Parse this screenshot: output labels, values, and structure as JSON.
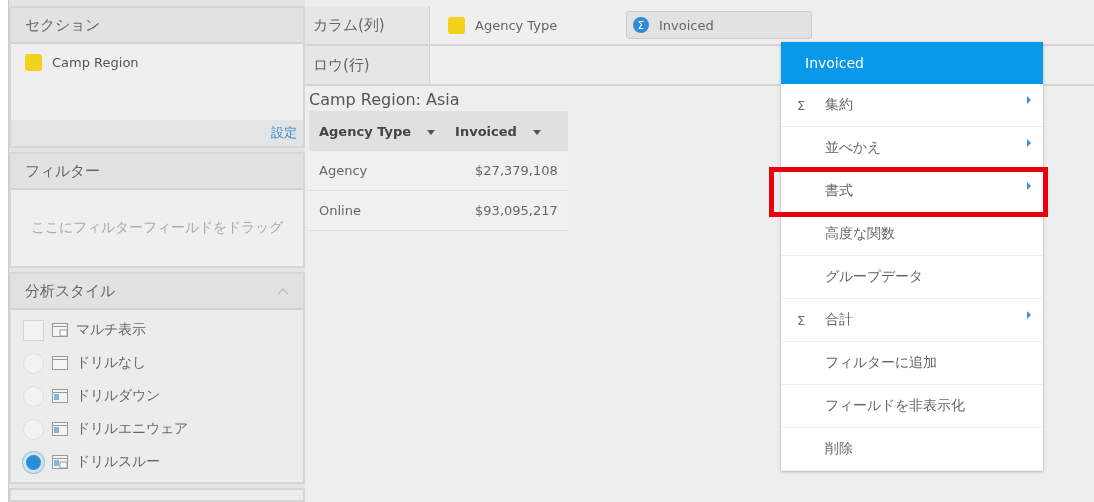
{
  "section_panel": {
    "title": "セクション",
    "fields": [
      {
        "label": "Camp Region",
        "color": "#f2d21b"
      }
    ],
    "settings_link": "設定"
  },
  "filter_panel": {
    "title": "フィルター",
    "placeholder": "ここにフィルターフィールドをドラッグ"
  },
  "analysis_panel": {
    "title": "分析スタイル",
    "expanded": true,
    "options": [
      {
        "kind": "checkbox",
        "label": "マルチ表示",
        "checked": false
      },
      {
        "kind": "radio",
        "label": "ドリルなし",
        "selected": false
      },
      {
        "kind": "radio",
        "label": "ドリルダウン",
        "selected": false
      },
      {
        "kind": "radio",
        "label": "ドリルエニウェア",
        "selected": false
      },
      {
        "kind": "radio",
        "label": "ドリルスルー",
        "selected": true
      }
    ]
  },
  "columns_shelf": {
    "label": "カラム(列)",
    "fields": [
      {
        "kind": "dimension",
        "label": "Agency Type",
        "color": "#f2d21b",
        "selected": false
      },
      {
        "kind": "measure",
        "label": "Invoiced",
        "icon": "Σ",
        "selected": true
      }
    ]
  },
  "rows_shelf": {
    "label": "ロウ(行)"
  },
  "report": {
    "title": "Camp Region: Asia",
    "columns": [
      "Agency Type",
      "Invoiced"
    ],
    "rows": [
      [
        "Agency",
        "$27,379,108"
      ],
      [
        "Online",
        "$93,095,217"
      ]
    ]
  },
  "context_menu": {
    "title": "Invoiced",
    "items": [
      {
        "icon": "Σ",
        "label": "集約",
        "submenu": true,
        "highlighted": false
      },
      {
        "label": "並べかえ",
        "submenu": true,
        "highlighted": false
      },
      {
        "label": "書式",
        "submenu": true,
        "highlighted": true
      },
      {
        "label": "高度な関数",
        "submenu": false,
        "highlighted": false
      },
      {
        "label": "グループデータ",
        "submenu": false,
        "highlighted": false
      },
      {
        "icon": "Σ",
        "label": "合計",
        "submenu": true,
        "highlighted": false
      },
      {
        "label": "フィルターに追加",
        "submenu": false,
        "highlighted": false
      },
      {
        "label": "フィールドを非表示化",
        "submenu": false,
        "highlighted": false
      },
      {
        "label": "削除",
        "submenu": false,
        "highlighted": false
      }
    ]
  }
}
